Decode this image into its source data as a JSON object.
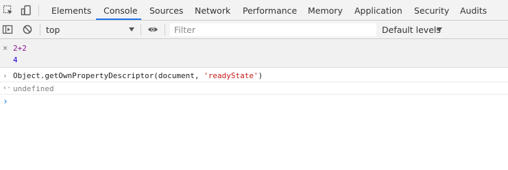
{
  "tabbar": {
    "icons": {
      "inspect": "inspect-element-icon",
      "device": "device-toolbar-icon"
    },
    "tabs": [
      {
        "label": "Elements"
      },
      {
        "label": "Console"
      },
      {
        "label": "Sources"
      },
      {
        "label": "Network"
      },
      {
        "label": "Performance"
      },
      {
        "label": "Memory"
      },
      {
        "label": "Application"
      },
      {
        "label": "Security"
      },
      {
        "label": "Audits"
      }
    ],
    "active_tab": "Console"
  },
  "toolbar": {
    "icons": {
      "sidebar": "show-sidebar-icon",
      "clear": "clear-console-icon",
      "eye": "live-expression-eye-icon"
    },
    "context": "top",
    "filter_placeholder": "Filter",
    "levels": "Default levels"
  },
  "console": {
    "entries": [
      {
        "gutter": "×",
        "input": "2+2",
        "output": "4"
      },
      {
        "gutter": "›",
        "code_before": "Object.getOwnPropertyDescriptor(document, ",
        "code_string": "'readyState'",
        "code_after": ")",
        "result_gutter": "‹·",
        "result": "undefined"
      }
    ],
    "prompt": "›"
  },
  "colors": {
    "accent": "#1a73e8",
    "string": "#c41a16",
    "number": "#1c00cf",
    "input_purple": "#881391",
    "muted": "#808080"
  }
}
